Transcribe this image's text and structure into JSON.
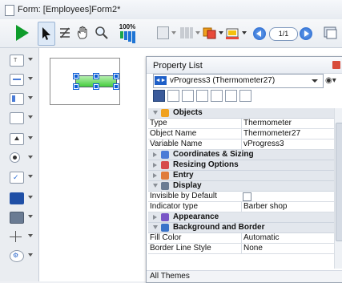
{
  "window": {
    "title": "Form: [Employees]Form2*",
    "title_icon": "form-icon"
  },
  "toolbar": {
    "zoom_label": "100%",
    "page_value": "1/1",
    "icons": [
      "run-icon",
      "select-arrow-icon",
      "list-order-icon",
      "hand-icon",
      "zoom-icon",
      "zoom-level-icon",
      "align-icon",
      "distribute-icon",
      "arrange-icon",
      "color-icon",
      "prev-page-icon",
      "page-field",
      "next-page-icon",
      "views-icon"
    ]
  },
  "left_panel": {
    "tools": [
      "text-object-tool",
      "field-tool",
      "list-tool",
      "combo-tool",
      "button-tool",
      "radio-tool",
      "checkbox-tool",
      "indicator-tool",
      "rectangle-tool",
      "splitter-tool",
      "plugin-tool"
    ]
  },
  "property_list": {
    "title": "Property List",
    "selected_object": "vProgress3 (Thermometer27)",
    "footer": "All Themes",
    "sections": [
      {
        "label": "Objects",
        "open": true,
        "icon": "objects-icon",
        "color": "#f0a11e"
      },
      {
        "label": "Coordinates & Sizing",
        "open": false,
        "icon": "coordinates-icon",
        "color": "#4a7bd6"
      },
      {
        "label": "Resizing Options",
        "open": false,
        "icon": "resizing-icon",
        "color": "#d64a4a"
      },
      {
        "label": "Entry",
        "open": false,
        "icon": "entry-icon",
        "color": "#e07b39"
      },
      {
        "label": "Display",
        "open": true,
        "icon": "display-icon",
        "color": "#6b7c93"
      },
      {
        "label": "Appearance",
        "open": false,
        "icon": "appearance-icon",
        "color": "#7a56c7"
      },
      {
        "label": "Background and Border",
        "open": true,
        "icon": "background-icon",
        "color": "#3a73c9"
      }
    ],
    "rows": {
      "type": {
        "label": "Type",
        "value": "Thermometer"
      },
      "object_name": {
        "label": "Object Name",
        "value": "Thermometer27"
      },
      "variable_name": {
        "label": "Variable Name",
        "value": "vProgress3"
      },
      "invisible_default": {
        "label": "Invisible by Default",
        "value": ""
      },
      "indicator_type": {
        "label": "Indicator type",
        "value": "Barber shop"
      },
      "fill_color": {
        "label": "Fill Color",
        "value": "Automatic"
      },
      "border_style": {
        "label": "Border Line Style",
        "value": "None"
      }
    }
  }
}
